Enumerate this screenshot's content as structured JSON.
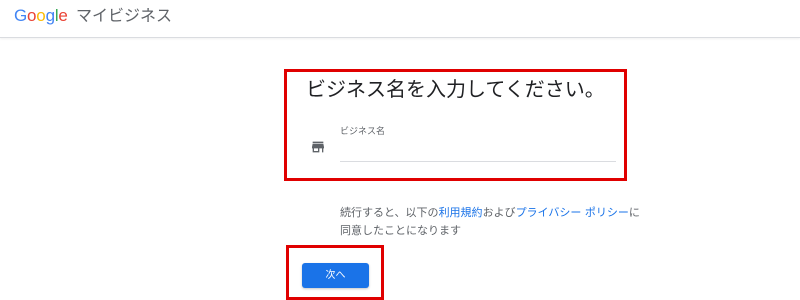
{
  "header": {
    "logo_letters": [
      "G",
      "o",
      "o",
      "g",
      "l",
      "e"
    ],
    "product_name": "マイビジネス"
  },
  "form": {
    "title": "ビジネス名を入力してください。",
    "field_label": "ビジネス名",
    "field_value": "",
    "field_icon": "storefront-icon"
  },
  "terms": {
    "prefix": "続行すると、以下の",
    "terms_link": "利用規約",
    "middle": "および",
    "privacy_link": "プライバシー ポリシー",
    "suffix": "に同意したことになります"
  },
  "actions": {
    "next_label": "次へ"
  },
  "colors": {
    "highlight": "#e00000",
    "primary_button": "#1a73e8",
    "link": "#1a73e8"
  }
}
